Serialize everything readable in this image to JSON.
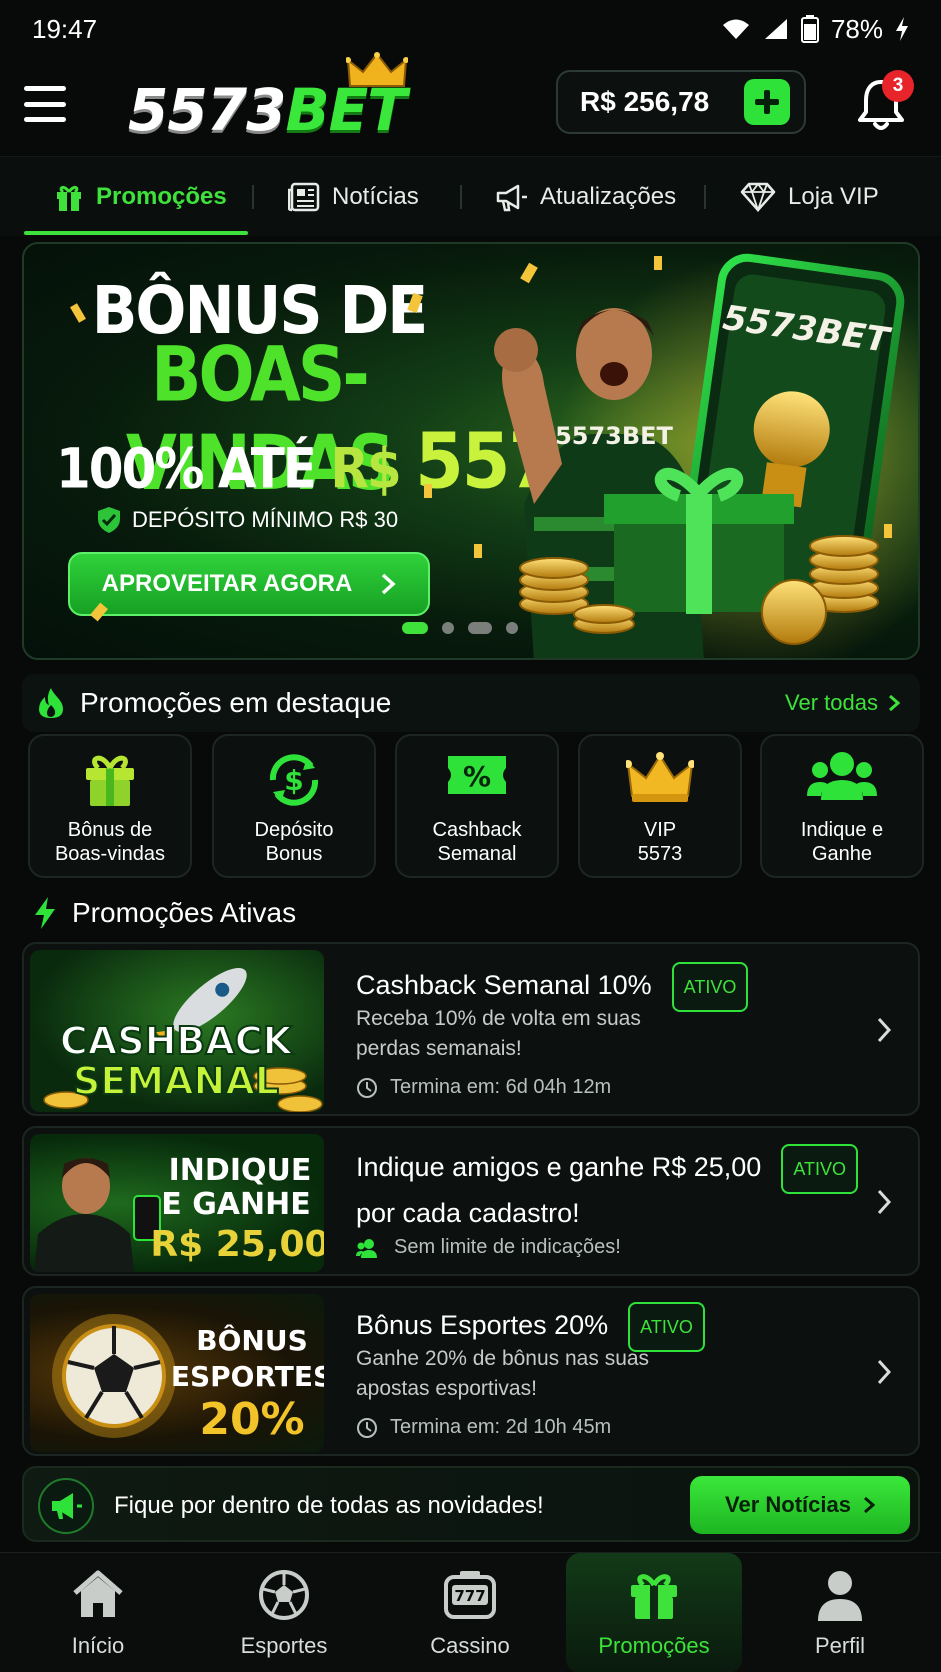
{
  "status_bar": {
    "time": "19:47",
    "battery": "78%"
  },
  "header": {
    "logo_number": "5573",
    "logo_bet": "BET",
    "balance": "R$ 256,78",
    "notifications_count": "3"
  },
  "tabs": [
    {
      "label": "Promoções",
      "icon": "gift-icon",
      "active": true
    },
    {
      "label": "Notícias",
      "icon": "newspaper-icon"
    },
    {
      "label": "Atualizações",
      "icon": "megaphone-icon"
    },
    {
      "label": "Loja VIP",
      "icon": "diamond-icon"
    }
  ],
  "hero": {
    "title_line1": "BÔNUS DE",
    "title_line2": "BOAS-VINDAS",
    "subtitle_prefix": "100% ATÉ ",
    "subtitle_currency": "R$",
    "subtitle_amount": "557",
    "min_deposit": "DEPÓSITO MÍNIMO R$ 30",
    "cta": "APROVEITAR AGORA",
    "art_logo": "5573BET",
    "slide_count": 4,
    "active_slide": 1
  },
  "featured": {
    "title": "Promoções em destaque",
    "see_all": "Ver todas",
    "items": [
      {
        "label": "Bônus de\nBoas-vindas",
        "icon": "gift-icon"
      },
      {
        "label": "Depósito\nBonus",
        "icon": "dollar-refresh-icon"
      },
      {
        "label": "Cashback\nSemanal",
        "icon": "percent-ticket-icon"
      },
      {
        "label": "VIP\n5573",
        "icon": "crown-icon"
      },
      {
        "label": "Indique e\nGanhe",
        "icon": "users-icon"
      }
    ]
  },
  "active": {
    "title": "Promoções Ativas",
    "items": [
      {
        "title": "Cashback Semanal 10%",
        "badge": "ATIVO",
        "desc_line1": "Receba 10% de volta em suas",
        "desc_line2": "perdas semanais!",
        "meta": "Termina em: 6d 04h 12m",
        "image_text1": "CASHBACK",
        "image_text2": "SEMANAL"
      },
      {
        "title_line1": "Indique amigos e ganhe R$ 25,00",
        "title_line2": "por cada cadastro!",
        "badge": "ATIVO",
        "meta": "Sem limite de indicações!",
        "image_text1": "INDIQUE",
        "image_text2": "E GANHE",
        "image_text3": "R$ 25,00"
      },
      {
        "title": "Bônus Esportes 20%",
        "badge": "ATIVO",
        "desc_line1": "Ganhe 20% de bônus nas suas",
        "desc_line2": "apostas esportivas!",
        "meta": "Termina em: 2d 10h 45m",
        "image_text1": "BÔNUS",
        "image_text2": "ESPORTES",
        "image_text3": "20%"
      }
    ]
  },
  "news_banner": {
    "text": "Fique por dentro de todas as novidades!",
    "button": "Ver Notícias"
  },
  "bottom_nav": [
    {
      "label": "Início",
      "icon": "home-icon"
    },
    {
      "label": "Esportes",
      "icon": "soccer-ball-icon"
    },
    {
      "label": "Cassino",
      "icon": "slot-machine-icon"
    },
    {
      "label": "Promoções",
      "icon": "gift-icon",
      "active": true
    },
    {
      "label": "Perfil",
      "icon": "user-icon"
    }
  ],
  "colors": {
    "accent": "#3ee23b",
    "background": "#070a09",
    "badge_red": "#e8242b"
  }
}
